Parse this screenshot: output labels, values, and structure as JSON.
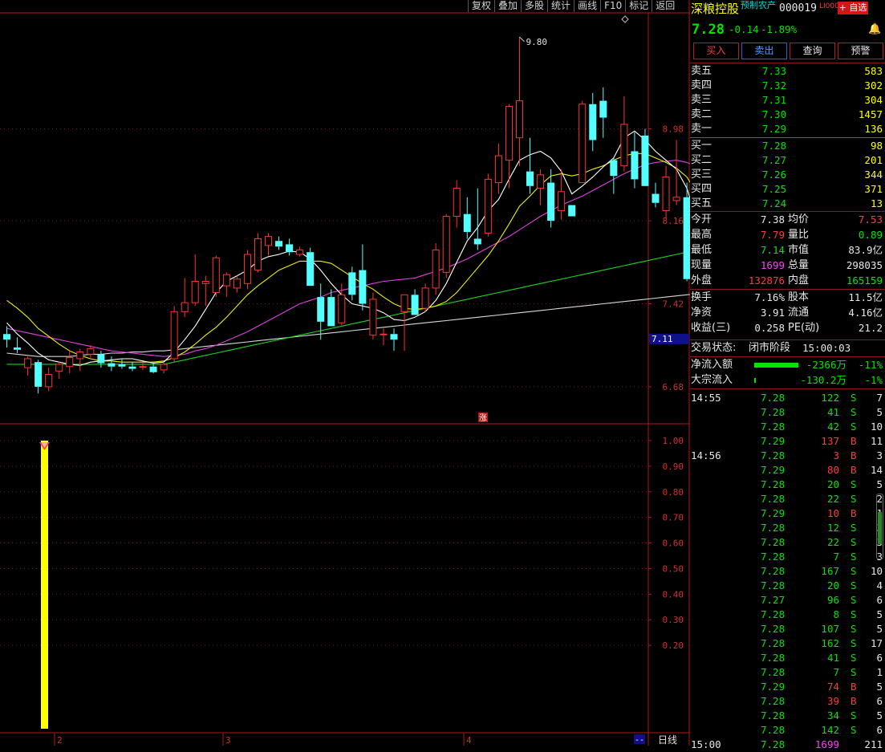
{
  "toolbar": {
    "buttons": [
      "复权",
      "叠加",
      "多股",
      "统计",
      "画线",
      "F10",
      "标记",
      "返回"
    ]
  },
  "stock": {
    "name": "深粮控股",
    "tag": "预制农产",
    "code": "000019",
    "level": "LI000",
    "add_watch": "+ 自选",
    "price": "7.28",
    "change": "-0.14",
    "change_pct": "-1.89%"
  },
  "actions": {
    "buy": "买入",
    "sell": "卖出",
    "query": "查询",
    "alert": "预警"
  },
  "order_book": {
    "asks": [
      {
        "label": "卖五",
        "price": "7.33",
        "vol": "583"
      },
      {
        "label": "卖四",
        "price": "7.32",
        "vol": "302"
      },
      {
        "label": "卖三",
        "price": "7.31",
        "vol": "304"
      },
      {
        "label": "卖二",
        "price": "7.30",
        "vol": "1457"
      },
      {
        "label": "卖一",
        "price": "7.29",
        "vol": "136"
      }
    ],
    "bids": [
      {
        "label": "买一",
        "price": "7.28",
        "vol": "98"
      },
      {
        "label": "买二",
        "price": "7.27",
        "vol": "201"
      },
      {
        "label": "买三",
        "price": "7.26",
        "vol": "344"
      },
      {
        "label": "买四",
        "price": "7.25",
        "vol": "371"
      },
      {
        "label": "买五",
        "price": "7.24",
        "vol": "13"
      }
    ]
  },
  "stats": {
    "open_label": "今开",
    "open": "7.38",
    "avg_label": "均价",
    "avg": "7.53",
    "high_label": "最高",
    "high": "7.79",
    "vr_label": "量比",
    "vr": "0.89",
    "low_label": "最低",
    "low": "7.14",
    "mcap_label": "市值",
    "mcap": "83.9亿",
    "cur_label": "现量",
    "cur": "1699",
    "tvol_label": "总量",
    "tvol": "298035",
    "out_label": "外盘",
    "out": "132876",
    "in_label": "内盘",
    "in": "165159",
    "turn_label": "换手",
    "turn": "7.16%",
    "cap_label": "股本",
    "cap": "11.5亿",
    "nav_label": "净资",
    "nav": "3.91",
    "float_label": "流通",
    "float": "4.16亿",
    "eps_label": "收益(三)",
    "eps": "0.258",
    "pe_label": "PE(动)",
    "pe": "21.2"
  },
  "status": {
    "label": "交易状态:",
    "value": "闭市阶段",
    "time": "15:00:03"
  },
  "flows": [
    {
      "label": "净流入额",
      "value": "-2366万",
      "pct": "-11%",
      "bar": 1.0
    },
    {
      "label": "大宗流入",
      "value": "-130.2万",
      "pct": "-1%",
      "bar": 0.04
    }
  ],
  "ticks": [
    {
      "time": "14:55",
      "price": "7.28",
      "vol": "122",
      "side": "S",
      "n": "7"
    },
    {
      "time": "",
      "price": "7.28",
      "vol": "41",
      "side": "S",
      "n": "5"
    },
    {
      "time": "",
      "price": "7.28",
      "vol": "42",
      "side": "S",
      "n": "10"
    },
    {
      "time": "",
      "price": "7.29",
      "vol": "137",
      "side": "B",
      "n": "11"
    },
    {
      "time": "14:56",
      "price": "7.28",
      "vol": "3",
      "side": "B",
      "n": "3"
    },
    {
      "time": "",
      "price": "7.29",
      "vol": "80",
      "side": "B",
      "n": "14"
    },
    {
      "time": "",
      "price": "7.28",
      "vol": "20",
      "side": "S",
      "n": "5"
    },
    {
      "time": "",
      "price": "7.28",
      "vol": "22",
      "side": "S",
      "n": "2"
    },
    {
      "time": "",
      "price": "7.29",
      "vol": "10",
      "side": "B",
      "n": "1"
    },
    {
      "time": "",
      "price": "7.28",
      "vol": "12",
      "side": "S",
      "n": "3"
    },
    {
      "time": "",
      "price": "7.28",
      "vol": "22",
      "side": "S",
      "n": "3"
    },
    {
      "time": "",
      "price": "7.28",
      "vol": "7",
      "side": "S",
      "n": "3"
    },
    {
      "time": "",
      "price": "7.28",
      "vol": "167",
      "side": "S",
      "n": "10"
    },
    {
      "time": "",
      "price": "7.28",
      "vol": "20",
      "side": "S",
      "n": "4"
    },
    {
      "time": "",
      "price": "7.27",
      "vol": "96",
      "side": "S",
      "n": "6"
    },
    {
      "time": "",
      "price": "7.28",
      "vol": "8",
      "side": "S",
      "n": "5"
    },
    {
      "time": "",
      "price": "7.28",
      "vol": "107",
      "side": "S",
      "n": "5"
    },
    {
      "time": "",
      "price": "7.28",
      "vol": "162",
      "side": "S",
      "n": "17"
    },
    {
      "time": "",
      "price": "7.28",
      "vol": "41",
      "side": "S",
      "n": "6"
    },
    {
      "time": "",
      "price": "7.28",
      "vol": "7",
      "side": "S",
      "n": "1"
    },
    {
      "time": "",
      "price": "7.29",
      "vol": "74",
      "side": "B",
      "n": "5"
    },
    {
      "time": "",
      "price": "7.28",
      "vol": "39",
      "side": "B",
      "n": "6"
    },
    {
      "time": "",
      "price": "7.28",
      "vol": "34",
      "side": "S",
      "n": "5"
    },
    {
      "time": "",
      "price": "7.28",
      "vol": "142",
      "side": "S",
      "n": "6"
    },
    {
      "time": "15:00",
      "price": "7.28",
      "vol": "1699",
      "side": "",
      "n": "211"
    }
  ],
  "chart_data": {
    "type": "candlestick",
    "price_axis": [
      "8.98",
      "8.16",
      "7.42",
      "6.68"
    ],
    "ylim": [
      6.35,
      10.0
    ],
    "current_price_label": "7.11",
    "peak_label": "9.80",
    "x_labels": [
      "2",
      "3",
      "4"
    ],
    "period": "日线",
    "rise_marker": "涨",
    "candles": [
      {
        "o": 7.15,
        "h": 7.22,
        "l": 7.03,
        "c": 7.1
      },
      {
        "o": 7.03,
        "h": 7.12,
        "l": 6.98,
        "c": 7.01
      },
      {
        "o": 6.85,
        "h": 6.95,
        "l": 6.78,
        "c": 6.93
      },
      {
        "o": 6.9,
        "h": 6.92,
        "l": 6.62,
        "c": 6.68
      },
      {
        "o": 6.68,
        "h": 6.85,
        "l": 6.64,
        "c": 6.79
      },
      {
        "o": 6.82,
        "h": 6.9,
        "l": 6.75,
        "c": 6.88
      },
      {
        "o": 6.86,
        "h": 7.0,
        "l": 6.8,
        "c": 6.94
      },
      {
        "o": 6.93,
        "h": 7.02,
        "l": 6.82,
        "c": 6.99
      },
      {
        "o": 6.97,
        "h": 7.05,
        "l": 6.94,
        "c": 7.02
      },
      {
        "o": 6.97,
        "h": 7.0,
        "l": 6.85,
        "c": 6.89
      },
      {
        "o": 6.89,
        "h": 6.95,
        "l": 6.82,
        "c": 6.86
      },
      {
        "o": 6.88,
        "h": 6.93,
        "l": 6.84,
        "c": 6.86
      },
      {
        "o": 6.86,
        "h": 6.9,
        "l": 6.82,
        "c": 6.84
      },
      {
        "o": 6.86,
        "h": 6.9,
        "l": 6.83,
        "c": 6.86
      },
      {
        "o": 6.86,
        "h": 6.9,
        "l": 6.8,
        "c": 6.81
      },
      {
        "o": 6.83,
        "h": 6.9,
        "l": 6.8,
        "c": 6.88
      },
      {
        "o": 6.93,
        "h": 7.4,
        "l": 6.9,
        "c": 7.35
      },
      {
        "o": 7.35,
        "h": 7.65,
        "l": 7.3,
        "c": 7.43
      },
      {
        "o": 7.43,
        "h": 7.86,
        "l": 7.4,
        "c": 7.62
      },
      {
        "o": 7.6,
        "h": 7.67,
        "l": 7.4,
        "c": 7.62
      },
      {
        "o": 7.52,
        "h": 7.85,
        "l": 7.48,
        "c": 7.83
      },
      {
        "o": 7.58,
        "h": 7.7,
        "l": 7.48,
        "c": 7.68
      },
      {
        "o": 7.56,
        "h": 7.67,
        "l": 7.52,
        "c": 7.64
      },
      {
        "o": 7.6,
        "h": 7.9,
        "l": 7.55,
        "c": 7.86
      },
      {
        "o": 7.72,
        "h": 8.05,
        "l": 7.7,
        "c": 8.0
      },
      {
        "o": 7.94,
        "h": 8.05,
        "l": 7.85,
        "c": 8.02
      },
      {
        "o": 7.98,
        "h": 8.02,
        "l": 7.9,
        "c": 7.93
      },
      {
        "o": 7.95,
        "h": 8.0,
        "l": 7.85,
        "c": 7.88
      },
      {
        "o": 7.86,
        "h": 7.93,
        "l": 7.84,
        "c": 7.9
      },
      {
        "o": 7.88,
        "h": 7.92,
        "l": 7.6,
        "c": 7.58
      },
      {
        "o": 7.48,
        "h": 7.6,
        "l": 7.1,
        "c": 7.26
      },
      {
        "o": 7.48,
        "h": 7.55,
        "l": 7.22,
        "c": 7.22
      },
      {
        "o": 7.25,
        "h": 7.6,
        "l": 7.23,
        "c": 7.5
      },
      {
        "o": 7.7,
        "h": 7.75,
        "l": 7.45,
        "c": 7.5
      },
      {
        "o": 7.72,
        "h": 7.95,
        "l": 7.36,
        "c": 7.42
      },
      {
        "o": 7.14,
        "h": 7.52,
        "l": 7.1,
        "c": 7.46
      },
      {
        "o": 7.15,
        "h": 7.2,
        "l": 7.05,
        "c": 7.15
      },
      {
        "o": 7.15,
        "h": 7.2,
        "l": 7.0,
        "c": 7.1
      },
      {
        "o": 7.35,
        "h": 7.5,
        "l": 7.0,
        "c": 7.5
      },
      {
        "o": 7.5,
        "h": 7.55,
        "l": 7.32,
        "c": 7.32
      },
      {
        "o": 7.38,
        "h": 7.6,
        "l": 7.35,
        "c": 7.56
      },
      {
        "o": 7.56,
        "h": 7.96,
        "l": 7.5,
        "c": 7.9
      },
      {
        "o": 7.7,
        "h": 8.22,
        "l": 7.65,
        "c": 8.2
      },
      {
        "o": 8.2,
        "h": 8.52,
        "l": 8.1,
        "c": 8.45
      },
      {
        "o": 8.22,
        "h": 8.37,
        "l": 8.0,
        "c": 8.06
      },
      {
        "o": 8.0,
        "h": 8.45,
        "l": 7.9,
        "c": 7.95
      },
      {
        "o": 8.05,
        "h": 8.58,
        "l": 8.02,
        "c": 8.53
      },
      {
        "o": 8.5,
        "h": 8.85,
        "l": 8.4,
        "c": 8.74
      },
      {
        "o": 8.7,
        "h": 9.2,
        "l": 8.45,
        "c": 9.18
      },
      {
        "o": 8.9,
        "h": 9.8,
        "l": 8.65,
        "c": 9.23
      },
      {
        "o": 8.6,
        "h": 8.9,
        "l": 8.4,
        "c": 8.47
      },
      {
        "o": 8.45,
        "h": 8.62,
        "l": 8.3,
        "c": 8.57
      },
      {
        "o": 8.5,
        "h": 8.62,
        "l": 8.1,
        "c": 8.16
      },
      {
        "o": 8.25,
        "h": 8.62,
        "l": 8.17,
        "c": 8.42
      },
      {
        "o": 8.3,
        "h": 8.3,
        "l": 8.2,
        "c": 8.2
      },
      {
        "o": 8.5,
        "h": 9.23,
        "l": 8.5,
        "c": 9.2
      },
      {
        "o": 9.2,
        "h": 9.3,
        "l": 8.78,
        "c": 8.88
      },
      {
        "o": 9.23,
        "h": 9.35,
        "l": 8.9,
        "c": 9.08
      },
      {
        "o": 8.7,
        "h": 8.72,
        "l": 8.4,
        "c": 8.56
      },
      {
        "o": 8.65,
        "h": 9.27,
        "l": 8.6,
        "c": 9.02
      },
      {
        "o": 8.78,
        "h": 8.95,
        "l": 8.45,
        "c": 8.53
      },
      {
        "o": 8.92,
        "h": 8.98,
        "l": 8.48,
        "c": 8.47
      },
      {
        "o": 8.4,
        "h": 8.5,
        "l": 8.28,
        "c": 8.32
      },
      {
        "o": 8.25,
        "h": 8.65,
        "l": 8.18,
        "c": 8.55
      },
      {
        "o": 8.34,
        "h": 8.88,
        "l": 8.3,
        "c": 8.37
      },
      {
        "o": 8.37,
        "h": 8.5,
        "l": 7.62,
        "c": 7.64
      },
      {
        "o": 7.48,
        "h": 7.5,
        "l": 7.25,
        "c": 7.31
      },
      {
        "o": 7.28,
        "h": 7.68,
        "l": 7.14,
        "c": 7.2
      }
    ],
    "ma5": [
      7.25,
      7.15,
      7.07,
      6.98,
      6.92,
      6.9,
      6.88,
      6.87,
      6.9,
      6.91,
      6.92,
      6.93,
      6.93,
      6.91,
      6.89,
      6.9,
      6.99,
      7.1,
      7.22,
      7.37,
      7.52,
      7.62,
      7.67,
      7.72,
      7.8,
      7.84,
      7.86,
      7.89,
      7.88,
      7.82,
      7.72,
      7.6,
      7.5,
      7.42,
      7.4,
      7.38,
      7.34,
      7.28,
      7.27,
      7.3,
      7.35,
      7.45,
      7.6,
      7.79,
      7.98,
      8.1,
      8.25,
      8.35,
      8.53,
      8.7,
      8.75,
      8.78,
      8.72,
      8.6,
      8.4,
      8.47,
      8.55,
      8.64,
      8.72,
      8.9,
      8.96,
      8.88,
      8.78,
      8.7,
      8.62,
      8.45,
      8.15,
      7.92
    ],
    "ma10": [
      7.45,
      7.38,
      7.3,
      7.2,
      7.13,
      7.06,
      7.0,
      6.96,
      6.93,
      6.91,
      6.91,
      6.9,
      6.9,
      6.9,
      6.9,
      6.91,
      6.94,
      6.99,
      7.06,
      7.14,
      7.21,
      7.3,
      7.4,
      7.5,
      7.58,
      7.65,
      7.72,
      7.76,
      7.8,
      7.8,
      7.8,
      7.78,
      7.72,
      7.66,
      7.6,
      7.55,
      7.48,
      7.42,
      7.38,
      7.37,
      7.38,
      7.4,
      7.44,
      7.52,
      7.63,
      7.74,
      7.85,
      7.98,
      8.13,
      8.29,
      8.38,
      8.48,
      8.56,
      8.58,
      8.56,
      8.58,
      8.62,
      8.65,
      8.7,
      8.74,
      8.76,
      8.76,
      8.72,
      8.68,
      8.63,
      8.55,
      8.4,
      8.25
    ],
    "ma20": [
      7.2,
      7.18,
      7.16,
      7.14,
      7.12,
      7.1,
      7.08,
      7.06,
      7.04,
      7.02,
      7.0,
      6.99,
      6.98,
      6.97,
      6.96,
      6.95,
      6.96,
      6.97,
      7.0,
      7.02,
      7.05,
      7.09,
      7.13,
      7.17,
      7.22,
      7.27,
      7.32,
      7.37,
      7.42,
      7.45,
      7.48,
      7.52,
      7.54,
      7.56,
      7.58,
      7.6,
      7.62,
      7.63,
      7.64,
      7.65,
      7.68,
      7.71,
      7.74,
      7.78,
      7.82,
      7.87,
      7.92,
      7.97,
      8.02,
      8.08,
      8.14,
      8.2,
      8.25,
      8.3,
      8.34,
      8.38,
      8.43,
      8.48,
      8.53,
      8.58,
      8.62,
      8.66,
      8.68,
      8.69,
      8.7,
      8.68,
      8.64,
      8.6
    ],
    "ma60": [
      6.88,
      6.88,
      6.88,
      6.88,
      6.88,
      6.88,
      6.88,
      6.88,
      6.88,
      6.88,
      6.88,
      6.88,
      6.88,
      6.88,
      6.88,
      6.88,
      6.9,
      6.92,
      6.94,
      6.96,
      6.98,
      7.0,
      7.02,
      7.04,
      7.06,
      7.08,
      7.1,
      7.12,
      7.14,
      7.16,
      7.18,
      7.2,
      7.22,
      7.24,
      7.26,
      7.28,
      7.3,
      7.32,
      7.34,
      7.36,
      7.38,
      7.4,
      7.42,
      7.44,
      7.46,
      7.48,
      7.5,
      7.52,
      7.54,
      7.56,
      7.58,
      7.6,
      7.62,
      7.64,
      7.66,
      7.68,
      7.7,
      7.72,
      7.74,
      7.76,
      7.78,
      7.8,
      7.82,
      7.84,
      7.86,
      7.88,
      7.9,
      7.92
    ],
    "ma120": [
      6.98,
      6.97,
      6.96,
      6.95,
      6.95,
      6.95,
      6.95,
      6.96,
      6.97,
      6.97,
      6.98,
      6.98,
      6.99,
      6.99,
      7.0,
      7.0,
      7.01,
      7.02,
      7.03,
      7.04,
      7.05,
      7.06,
      7.07,
      7.08,
      7.09,
      7.1,
      7.11,
      7.12,
      7.13,
      7.14,
      7.15,
      7.16,
      7.17,
      7.18,
      7.19,
      7.2,
      7.21,
      7.22,
      7.23,
      7.24,
      7.25,
      7.26,
      7.27,
      7.28,
      7.29,
      7.3,
      7.31,
      7.32,
      7.33,
      7.34,
      7.35,
      7.36,
      7.37,
      7.38,
      7.39,
      7.4,
      7.41,
      7.42,
      7.43,
      7.44,
      7.45,
      7.46,
      7.47,
      7.48,
      7.49,
      7.5,
      7.51,
      7.52
    ],
    "indicator": {
      "axis": [
        "1.00",
        "0.90",
        "0.80",
        "0.70",
        "0.60",
        "0.50",
        "0.40",
        "0.30",
        "0.20"
      ],
      "ylim": [
        0.0,
        1.0
      ],
      "bar_value": 1.0
    }
  }
}
